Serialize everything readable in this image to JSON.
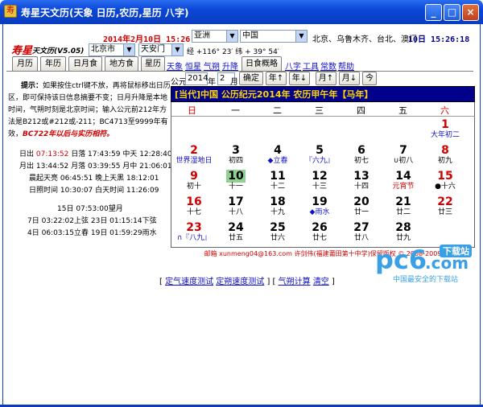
{
  "window": {
    "title": "寿星天文历(天象 日历,农历,星历 八字)",
    "buttons": [
      "_",
      "□",
      "×"
    ]
  },
  "header": {
    "local_time": "2014年2月10日 15:26:18",
    "region": "亚洲",
    "country": "中国",
    "cities_label": "北京、乌鲁木齐、台北、澳门",
    "city_time": "10日 15:26:18",
    "city": "北京市",
    "location": "天安门",
    "coords": "经 +116° 23′ 纬 + 39° 54′"
  },
  "logo": {
    "name": "寿星",
    "sub": "天文历(V5.05)"
  },
  "toolbar": {
    "tabs": [
      "月历",
      "年历",
      "日月食",
      "地方食",
      "星历",
      "日食概略"
    ],
    "links_row1": [
      "天象",
      "恒星",
      "气朔",
      "升降"
    ],
    "links_row2": [
      "八字",
      "工具",
      "常数",
      "帮助"
    ]
  },
  "info": {
    "tip_title": "提示：",
    "tip_lines": [
      "如果按住ctrl键不放，再将鼠标移出日历",
      "区，即可保持该日信息摘要不变；日月升降是本地",
      "时间，气朔时刻是北京时间；输入公元前212年方",
      "法是B212或#212或-211；BC4713至9999年有",
      "效，"
    ],
    "warning": "BC722年以后与实历相符。",
    "sun_label": "日出",
    "sun_rise_time": "07:13:52",
    "sun_rest": "日落 17:43:59 中天 12:28:40",
    "moon_line": "月出 13:44:52 月落 03:39:55 月中 21:06:01",
    "moon_light": "晨起天亮 06:45:51 晚上天黑 18:12:01",
    "day_len": "日照时间 10:30:07 白天时间 11:26:09",
    "full_moon": "15日 07:53:00望月",
    "phase1": "7日 03:22:02上弦 23日 01:15:14下弦",
    "phase2": "4日 06:03:15立春 19日 01:59:29雨水"
  },
  "calendar": {
    "prefix": "公元",
    "year": "2014",
    "year_unit": "年",
    "month": "2",
    "month_unit": "月",
    "confirm": "确定",
    "nav": [
      "年↑",
      "年↓",
      "月↑",
      "月↓",
      "今"
    ],
    "banner": "[当代]中国 公历纪元2014年 农历甲午年【马年】",
    "weekdays": [
      "日",
      "一",
      "二",
      "三",
      "四",
      "五",
      "六"
    ],
    "days": [
      {
        "n": "1",
        "l": "大年初二",
        "col": 6,
        "row": 0,
        "nc": "#d00000",
        "lc": "#1010c8"
      },
      {
        "n": "2",
        "l": "世界湿地日",
        "col": 0,
        "row": 1,
        "nc": "#d00000",
        "lc": "#1010c8"
      },
      {
        "n": "3",
        "l": "初四",
        "col": 1,
        "row": 1
      },
      {
        "n": "4",
        "l": "◆立春",
        "col": 2,
        "row": 1,
        "lc": "#1010c8"
      },
      {
        "n": "5",
        "l": "『六九』",
        "col": 3,
        "row": 1,
        "lc": "#1010c8"
      },
      {
        "n": "6",
        "l": "初七",
        "col": 4,
        "row": 1
      },
      {
        "n": "7",
        "l": "∪初八",
        "col": 5,
        "row": 1
      },
      {
        "n": "8",
        "l": "初九",
        "col": 6,
        "row": 1,
        "nc": "#d00000"
      },
      {
        "n": "9",
        "l": "初十",
        "col": 0,
        "row": 2,
        "nc": "#d00000"
      },
      {
        "n": "10",
        "l": "十一",
        "col": 1,
        "row": 2,
        "today": true
      },
      {
        "n": "11",
        "l": "十二",
        "col": 2,
        "row": 2
      },
      {
        "n": "12",
        "l": "十三",
        "col": 3,
        "row": 2
      },
      {
        "n": "13",
        "l": "十四",
        "col": 4,
        "row": 2
      },
      {
        "n": "14",
        "l": "元宵节",
        "col": 5,
        "row": 2,
        "lc": "#d00000"
      },
      {
        "n": "15",
        "l": "●十六",
        "col": 6,
        "row": 2,
        "nc": "#d00000"
      },
      {
        "n": "16",
        "l": "十七",
        "col": 0,
        "row": 3,
        "nc": "#d00000"
      },
      {
        "n": "17",
        "l": "十八",
        "col": 1,
        "row": 3
      },
      {
        "n": "18",
        "l": "十九",
        "col": 2,
        "row": 3
      },
      {
        "n": "19",
        "l": "◆雨水",
        "col": 3,
        "row": 3,
        "lc": "#1010c8"
      },
      {
        "n": "20",
        "l": "廿一",
        "col": 4,
        "row": 3
      },
      {
        "n": "21",
        "l": "廿二",
        "col": 5,
        "row": 3
      },
      {
        "n": "22",
        "l": "廿三",
        "col": 6,
        "row": 3,
        "nc": "#d00000"
      },
      {
        "n": "23",
        "l": "∩『八九』",
        "col": 0,
        "row": 4,
        "nc": "#d00000",
        "lc": "#1010c8"
      },
      {
        "n": "24",
        "l": "廿五",
        "col": 1,
        "row": 4
      },
      {
        "n": "25",
        "l": "廿六",
        "col": 2,
        "row": 4
      },
      {
        "n": "26",
        "l": "廿七",
        "col": 3,
        "row": 4
      },
      {
        "n": "27",
        "l": "廿八",
        "col": 4,
        "row": 4
      },
      {
        "n": "28",
        "l": "廿九",
        "col": 5,
        "row": 4
      }
    ],
    "footer": "邮箱 xunmeng04@163.com 许剑伟(福建莆田第十中学)保留版权 © 2008-2009"
  },
  "bottom_links": [
    "定气速度测试",
    "定朔速度测试",
    "气朔计算",
    "清空"
  ],
  "watermark": {
    "brand": "pc6",
    "suffix": ".com",
    "badge": "下载站",
    "slogan": "中国最安全的下载站"
  }
}
